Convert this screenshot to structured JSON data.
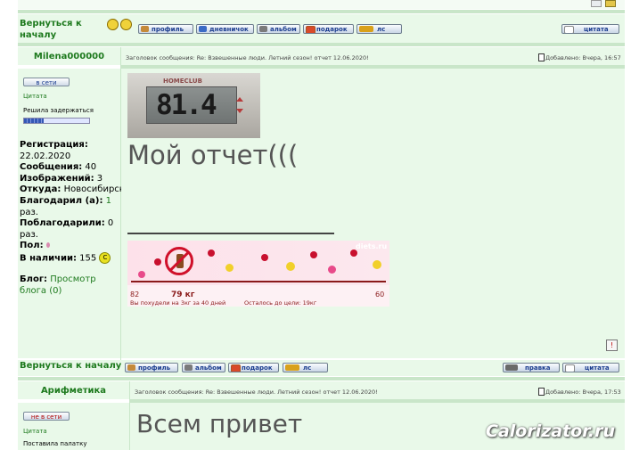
{
  "colors": {
    "panel_bg": "#e9f9e9",
    "accent_green": "#1e7a1e",
    "button_text": "#1b3d8f",
    "separator": "#c9e6c9"
  },
  "top": {
    "back_label": "Вернуться к началу",
    "buttons": [
      "профиль",
      "дневничок",
      "альбом",
      "подарок",
      "лс"
    ],
    "quote": "цитата"
  },
  "post1": {
    "author": "Milena000000",
    "subject": "Заголовок сообщения: Re: Взвешенные люди. Летний сезон! отчет 12.06.2020!",
    "added": "Добавлено: Вчера, 16:57",
    "status": "в сети",
    "quote_label": "Цитата",
    "rank": "Решила задержаться",
    "info": {
      "reg_label": "Регистрация:",
      "reg": "22.02.2020",
      "msgs_label": "Сообщения:",
      "msgs": "40",
      "imgs_label": "Изображений:",
      "imgs": "3",
      "from_label": "Откуда:",
      "from": "Новосибирск",
      "thanked_label": "Благодарил (а):",
      "thanked": "1",
      "thanked_unit": "раз.",
      "got_label": "Поблагодарили:",
      "got": "0",
      "got_unit": "раз.",
      "sex_label": "Пол:",
      "have_label": "В наличии:",
      "have": "155"
    },
    "blog_label": "Блог:",
    "blog_link": "Просмотр блога (0)",
    "scale_brand": "HOMECLUB",
    "scale_digits": "81.4",
    "body_text": "Мой отчет(((",
    "ticker": {
      "site": "diets.ru",
      "left": "82",
      "right": "60",
      "current": "79 кг",
      "caption1": "Вы похудели на 3кг за 40 дней",
      "caption2": "Осталось до цели: 19кг"
    },
    "back_label": "Вернуться к началу",
    "buttons": [
      "профиль",
      "альбом",
      "подарок",
      "лс"
    ],
    "edit": "правка",
    "quote": "цитата"
  },
  "post2": {
    "author": "Арифметика",
    "subject": "Заголовок сообщения: Re: Взвешенные люди. Летний сезон! отчет 12.06.2020!",
    "added": "Добавлено: Вчера, 17:53",
    "status": "не в сети",
    "quote_label": "Цитата",
    "rank": "Поставила палатку",
    "body_text": "Всем привет"
  },
  "watermark": "Calorizator.ru"
}
